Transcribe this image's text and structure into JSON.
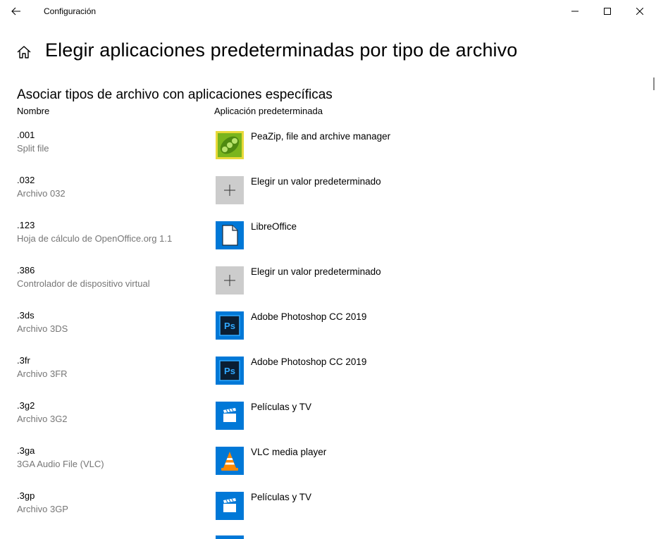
{
  "window": {
    "title": "Configuración",
    "back_icon": "arrow-left-icon",
    "controls": [
      "minimize-icon",
      "maximize-icon",
      "close-icon"
    ]
  },
  "header": {
    "home_icon": "home-icon",
    "title": "Elegir aplicaciones predeterminadas por tipo de archivo"
  },
  "section": {
    "title": "Asociar tipos de archivo con aplicaciones específicas",
    "col_name": "Nombre",
    "col_app": "Aplicación predeterminada"
  },
  "rows": [
    {
      "ext": ".001",
      "desc": "Split file",
      "app": "PeaZip, file and archive manager",
      "icon": "peazip-icon"
    },
    {
      "ext": ".032",
      "desc": "Archivo 032",
      "app": "Elegir un valor predeterminado",
      "icon": "plus-icon"
    },
    {
      "ext": ".123",
      "desc": "Hoja de cálculo de OpenOffice.org 1.1",
      "app": "LibreOffice",
      "icon": "libreoffice-icon"
    },
    {
      "ext": ".386",
      "desc": "Controlador de dispositivo virtual",
      "app": "Elegir un valor predeterminado",
      "icon": "plus-icon"
    },
    {
      "ext": ".3ds",
      "desc": "Archivo 3DS",
      "app": "Adobe Photoshop CC 2019",
      "icon": "photoshop-icon"
    },
    {
      "ext": ".3fr",
      "desc": "Archivo 3FR",
      "app": "Adobe Photoshop CC 2019",
      "icon": "photoshop-icon"
    },
    {
      "ext": ".3g2",
      "desc": "Archivo 3G2",
      "app": "Películas y TV",
      "icon": "movies-tv-icon"
    },
    {
      "ext": ".3ga",
      "desc": "3GA Audio File (VLC)",
      "app": "VLC media player",
      "icon": "vlc-icon"
    },
    {
      "ext": ".3gp",
      "desc": "Archivo 3GP",
      "app": "Películas y TV",
      "icon": "movies-tv-icon"
    }
  ],
  "colors": {
    "accent": "#0078d7",
    "secondary_text": "#767676",
    "placeholder_tile": "#cccccc"
  }
}
